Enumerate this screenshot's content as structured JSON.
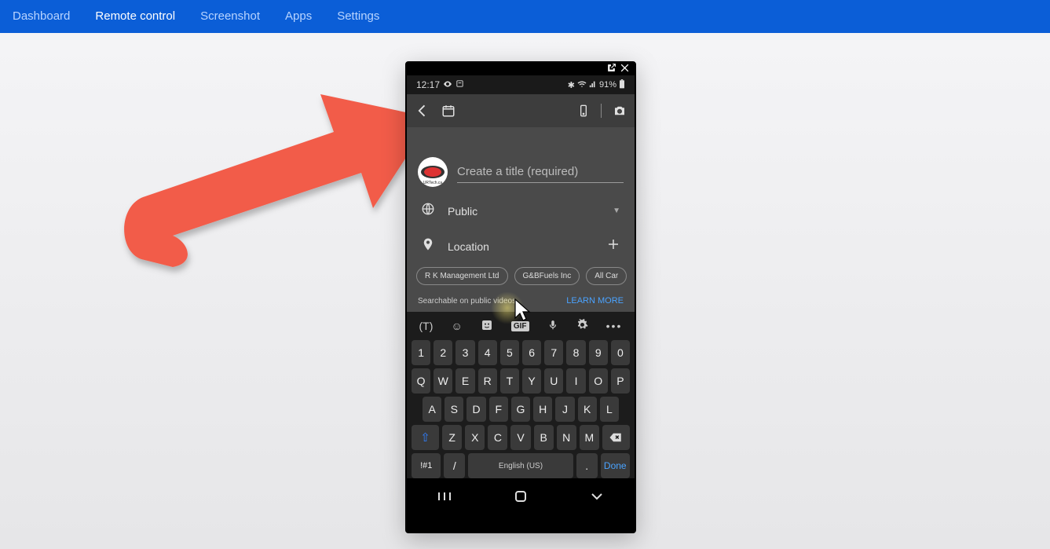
{
  "topbar": {
    "tabs": [
      "Dashboard",
      "Remote control",
      "Screenshot",
      "Apps",
      "Settings"
    ],
    "active_index": 1
  },
  "phone": {
    "status": {
      "time": "12:17",
      "battery": "91%"
    },
    "title_placeholder": "Create a title (required)",
    "avatar_label": "URTech.ca",
    "visibility_label": "Public",
    "location_label": "Location",
    "chips": [
      "R K Management Ltd",
      "G&BFuels Inc",
      "All Car"
    ],
    "searchable_note": "Searchable on public videos.",
    "learn_more": "LEARN MORE"
  },
  "keyboard": {
    "row_num": [
      "1",
      "2",
      "3",
      "4",
      "5",
      "6",
      "7",
      "8",
      "9",
      "0"
    ],
    "row_q": [
      "Q",
      "W",
      "E",
      "R",
      "T",
      "Y",
      "U",
      "I",
      "O",
      "P"
    ],
    "row_a": [
      "A",
      "S",
      "D",
      "F",
      "G",
      "H",
      "J",
      "K",
      "L"
    ],
    "row_z": [
      "Z",
      "X",
      "C",
      "V",
      "B",
      "N",
      "M"
    ],
    "sym": "!#1",
    "slash": "/",
    "lang": "English (US)",
    "period": ".",
    "done": "Done"
  }
}
